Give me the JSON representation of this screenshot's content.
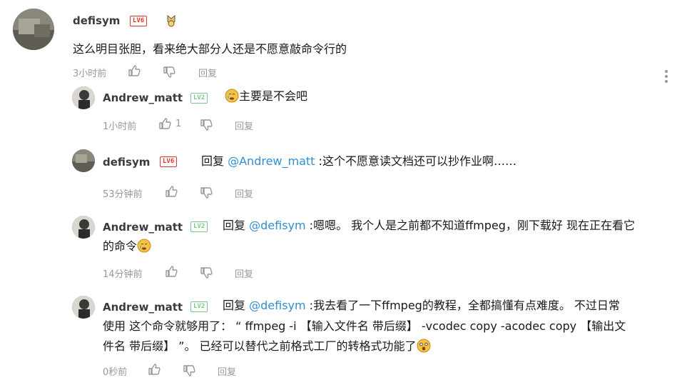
{
  "main_comment": {
    "username": "defisym",
    "level": "LV6",
    "content": "这么明目张胆，看来绝大部分人还是不愿意敲命令行的",
    "time": "3小时前",
    "reply_label": "回复"
  },
  "replies": [
    {
      "username": "Andrew_matt",
      "level": "LV2",
      "content": "主要是不会吧",
      "time": "1小时前",
      "likes": "1",
      "reply_label": "回复"
    },
    {
      "username": "defisym",
      "level": "LV6",
      "reply_prefix": "回复",
      "mention": "@Andrew_matt",
      "content": ":这个不愿意读文档还可以抄作业啊……",
      "time": "53分钟前",
      "reply_label": "回复"
    },
    {
      "username": "Andrew_matt",
      "level": "LV2",
      "reply_prefix": "回复",
      "mention": "@defisym",
      "content_line1": ":嗯嗯。 我个人是之前都不知道ffmpeg，刚下载好 现在正在看它",
      "content_line2": "的命令",
      "time": "14分钟前",
      "reply_label": "回复"
    },
    {
      "username": "Andrew_matt",
      "level": "LV2",
      "reply_prefix": "回复",
      "mention": "@defisym",
      "content_line1": ":我去看了一下ffmpeg的教程，全都搞懂有点难度。    不过日常",
      "content_line2": "使用 这个命令就够用了： “ ffmpeg -i 【输入文件名 带后缀】 -vcodec copy -acodec copy 【输出文",
      "content_line3": "件名 带后缀】 ”。    已经可以替代之前格式工厂的转格式功能了",
      "time": "0秒前",
      "reply_label": "回复"
    }
  ],
  "colors": {
    "mention": "#2f8fd1",
    "meta": "#9499a0",
    "lv6": "#e8322f",
    "lv2": "#7bc78f"
  },
  "icons": [
    "thumb-up-icon",
    "thumb-down-icon",
    "more-vertical-icon",
    "face-emoji-icon",
    "medal-icon"
  ]
}
